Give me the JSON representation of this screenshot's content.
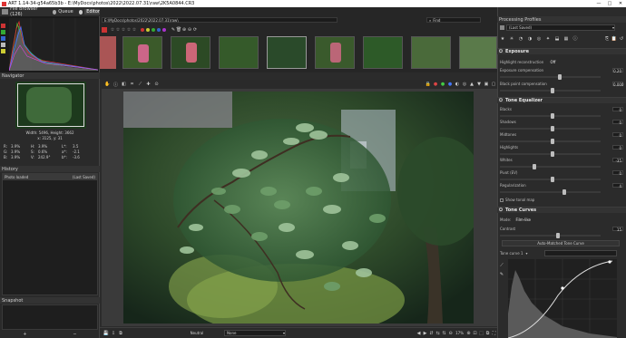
{
  "window": {
    "title": "ART 1.14-34-g54a65b3b - E:\\MyDocs\\photos\\2022\\2022.07.31\\raw\\2K5A0844.CR3",
    "controls": [
      "—",
      "□",
      "✕"
    ]
  },
  "tabs": {
    "file_browser": "File Browser (126)",
    "queue": "Queue",
    "editor": "Editor"
  },
  "path_bar": "E:\\MyDocs\\photos\\2022\\2022.07.31\\raw\\",
  "search_label": "Find",
  "navigator": {
    "title": "Navigator",
    "dims": "Width: 5496, Height: 3662",
    "zoom": "x: 3125, y: 31",
    "readout": [
      {
        "l": "R:",
        "v": "3.9%",
        "l2": "H:",
        "v2": "3.9%",
        "l3": "L*:",
        "v3": "3.5"
      },
      {
        "l": "G:",
        "v": "3.9%",
        "l2": "S:",
        "v2": "0.6%",
        "l3": "a*:",
        "v3": "-2.1"
      },
      {
        "l": "B:",
        "v": "3.9%",
        "l2": "V:",
        "v2": "242.9°",
        "l3": "b*:",
        "v3": "-3.6"
      }
    ]
  },
  "history": {
    "title": "History",
    "rows": [
      [
        "Photo loaded",
        "(Last Saved)"
      ]
    ]
  },
  "snapshot": {
    "title": "Snapshot",
    "add": "+",
    "remove": "−"
  },
  "processing_profiles": {
    "title": "Processing Profiles",
    "selected": "(Last Saved)"
  },
  "exposure": {
    "title": "Exposure",
    "highlight_reconstruction_label": "Highlight reconstruction",
    "highlight_reconstruction_value": "Off",
    "exposure_comp_label": "Exposure compensation",
    "exposure_comp_value": "0.20",
    "black_point_label": "Black point compensation",
    "black_point_value": "0.000"
  },
  "tone_equalizer": {
    "title": "Tone Equalizer",
    "bands": [
      {
        "label": "Blacks",
        "value": "0"
      },
      {
        "label": "Shadows",
        "value": "0"
      },
      {
        "label": "Midtones",
        "value": "0"
      },
      {
        "label": "Highlights",
        "value": "0"
      },
      {
        "label": "Whites",
        "value": "-35"
      },
      {
        "label": "Pivot (EV)",
        "value": "0"
      },
      {
        "label": "Regularization",
        "value": "4"
      }
    ],
    "show_tone_map": "Show tonal map"
  },
  "tone_curves": {
    "title": "Tone Curves",
    "mode_label": "Mode:",
    "mode_value": "Film-like",
    "contrast_label": "Contrast",
    "contrast_value": "15",
    "auto_curve_label": "Auto-Matched Tone Curve",
    "tone_curve_label": "Tone curve 1"
  },
  "bottom_bar": {
    "preset_label": "Neutral",
    "zoom_value": "None",
    "zoom_percent": "17%"
  }
}
